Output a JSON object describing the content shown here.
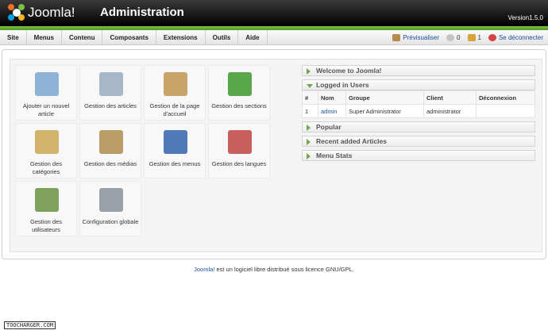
{
  "header": {
    "logo_text": "Joomla!",
    "title": "Administration",
    "version": "Version1.5.0"
  },
  "menu": {
    "items": [
      "Site",
      "Menus",
      "Contenu",
      "Composants",
      "Extensions",
      "Outils",
      "Aide"
    ]
  },
  "status": {
    "preview": "Prévisualiser",
    "messages_count": "0",
    "users_count": "1",
    "logout": "Se déconnecter"
  },
  "cpanel": [
    {
      "label": "Ajouter un nouvel article",
      "icon": "add-article-icon",
      "color": "#8fb3d6"
    },
    {
      "label": "Gestion des articles",
      "icon": "articles-icon",
      "color": "#a7b6c9"
    },
    {
      "label": "Gestion de la page d'accueil",
      "icon": "home-icon",
      "color": "#c9a46a"
    },
    {
      "label": "Gestion des sections",
      "icon": "sections-icon",
      "color": "#5aa64a"
    },
    {
      "label": "Gestion des catégories",
      "icon": "categories-icon",
      "color": "#d1b36b"
    },
    {
      "label": "Gestion des médias",
      "icon": "media-icon",
      "color": "#b99d67"
    },
    {
      "label": "Gestion des menus",
      "icon": "menus-icon",
      "color": "#4f79b7"
    },
    {
      "label": "Gestion des langues",
      "icon": "languages-icon",
      "color": "#c86060"
    },
    {
      "label": "Gestion des utilisateurs",
      "icon": "users-icon",
      "color": "#7fa35c"
    },
    {
      "label": "Configuration globale",
      "icon": "config-icon",
      "color": "#9aa0a8"
    }
  ],
  "panels": {
    "welcome": "Welcome to Joomla!",
    "logged_in": "Logged in Users",
    "popular": "Popular",
    "recent": "Recent added Articles",
    "menu_stats": "Menu Stats"
  },
  "users_table": {
    "headers": [
      "#",
      "Nom",
      "Groupe",
      "Client",
      "Déconnexion"
    ],
    "rows": [
      [
        "1",
        "admin",
        "Super Administrator",
        "administrator",
        ""
      ]
    ]
  },
  "footer": {
    "link": "Joomla!",
    "text": " est un logiciel libre distribué sous licence GNU/GPL."
  },
  "watermark": "TOOCHARGER.COM",
  "colors": {
    "accent_green": "#6fa84a",
    "link_blue": "#1d4fa0"
  }
}
